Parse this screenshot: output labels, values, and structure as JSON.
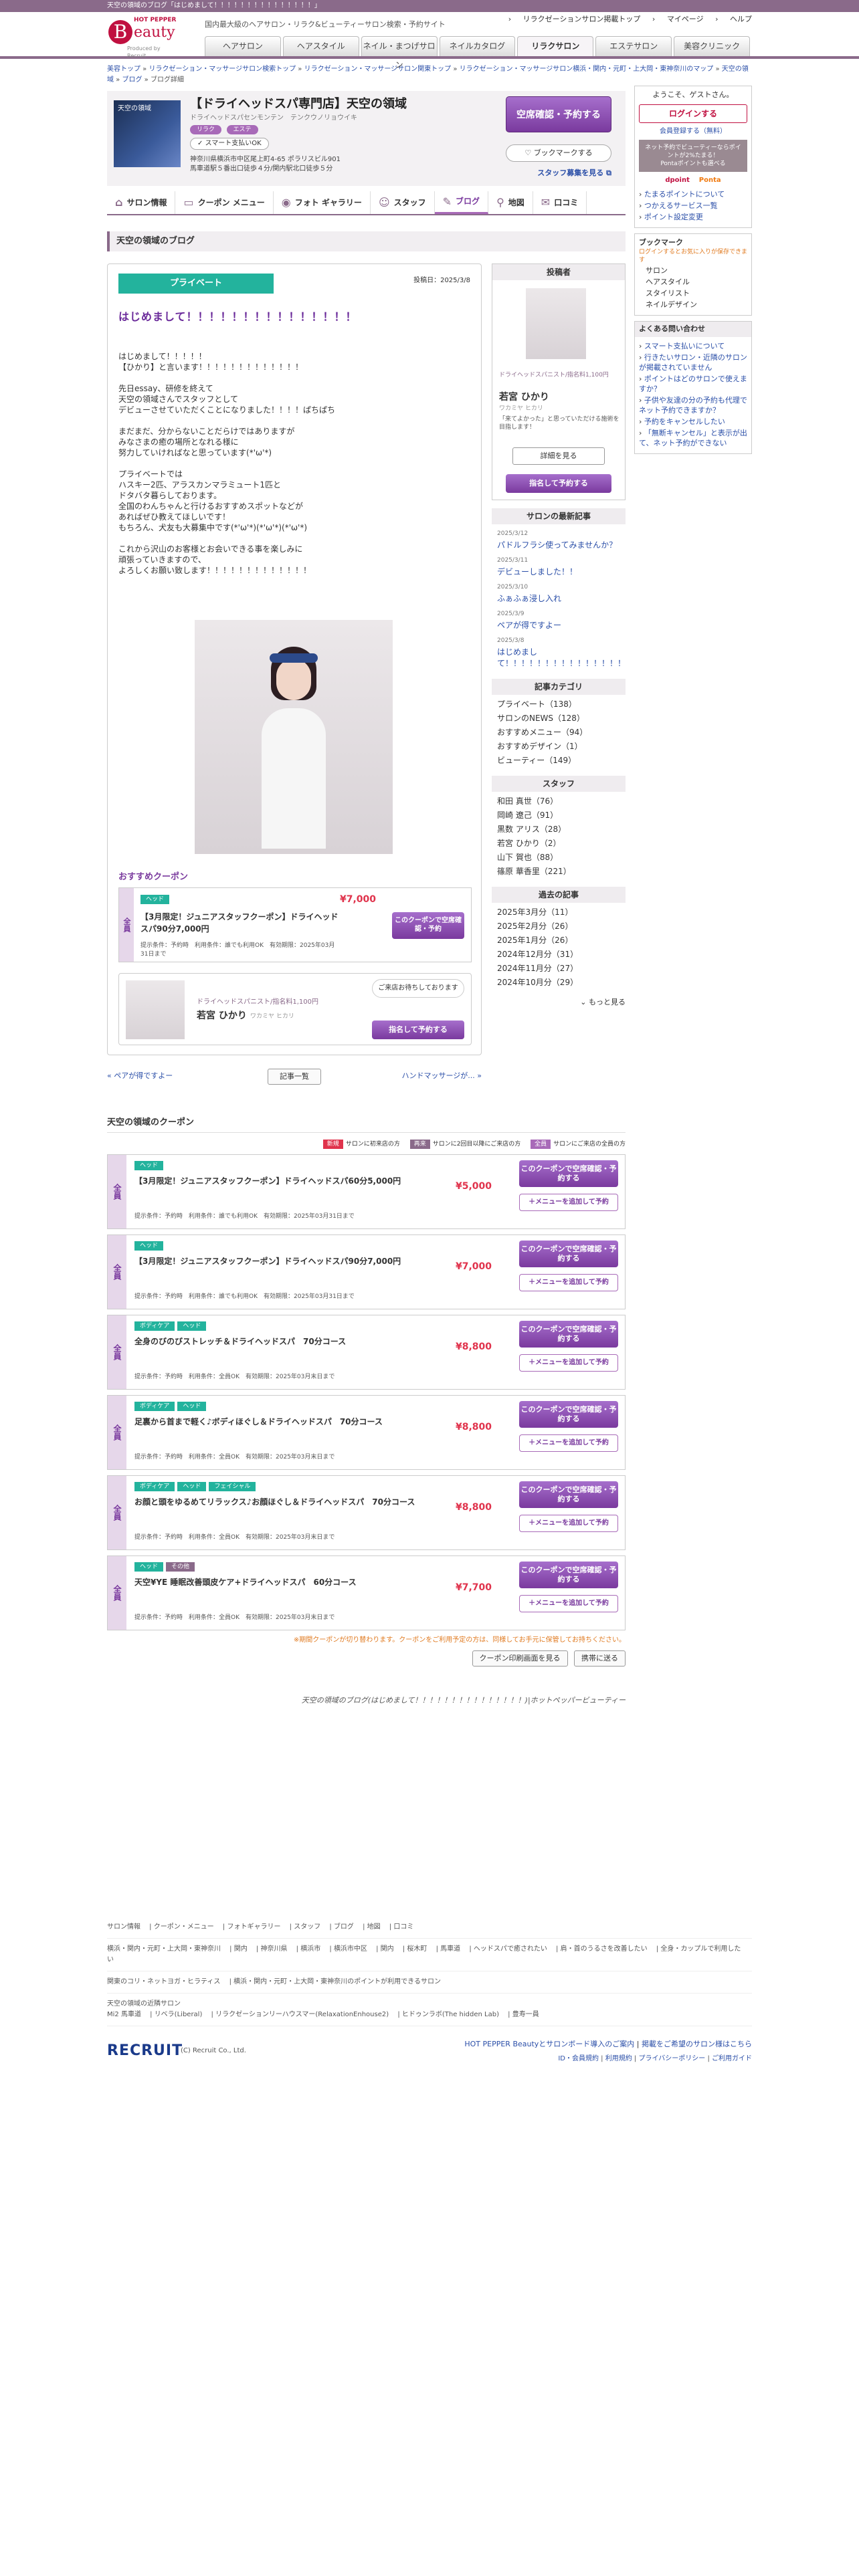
{
  "topbar": {
    "text": "天空の領域のブログ「はじめまして！！！！！！！！！！！！！！！」"
  },
  "header": {
    "logo_small": "HOT PEPPER",
    "logo_mark": "B",
    "logo_text": "eauty",
    "logo_powered": "Produced by Recruit",
    "tagline": "国内最大級のヘアサロン・リラク&ビューティーサロン検索・予約サイト",
    "util": [
      "リラクゼーションサロン掲載トップ",
      "マイページ",
      "ヘルプ"
    ],
    "tabs": [
      "ヘアサロン",
      "ヘアスタイル",
      "ネイル・まつげサロン",
      "ネイルカタログ",
      "リラクサロン",
      "エステサロン",
      "美容クリニック"
    ]
  },
  "breadcrumb": [
    "美容トップ",
    "リラクゼーション・マッサージサロン検索トップ",
    "リラクゼーション・マッサージサロン関東トップ",
    "リラクゼーション・マッサージサロン横浜・関内・元町・上大岡・東神奈川のマップ",
    "天空の領域",
    "ブログ",
    "ブログ詳細"
  ],
  "salon": {
    "image_text": "天空の領域",
    "name": "【ドライヘッドスパ専門店】天空の領域",
    "kana": "ドライヘッドスパセンモンテン　テンクウノリョウイキ",
    "tags": [
      "リラク",
      "エステ"
    ],
    "sp_label": "スマート支払いOK",
    "address": "神奈川県横浜市中区尾上町4-65 ポラリスビル901",
    "access": "馬車道駅５番出口徒歩４分/関内駅北口徒歩５分",
    "reserve_btn": "空席確認・予約する",
    "bookmark_btn": "ブックマークする",
    "staff_recruit": "スタッフ募集を見る"
  },
  "salon_nav": [
    "サロン情報",
    "クーポン メニュー",
    "フォト ギャラリー",
    "スタッフ",
    "ブログ",
    "地図",
    "口コミ"
  ],
  "salon_nav_icons": [
    "house-icon",
    "ticket-icon",
    "camera-icon",
    "people-icon",
    "pencil-icon",
    "pin-icon",
    "chat-icon"
  ],
  "section_title": "天空の領域のブログ",
  "blog": {
    "category": "プライベート",
    "date": "投稿日：2025/3/8",
    "title": "はじめまして！！！！！！！！！！！！！！！",
    "body": [
      "はじめまして！！！！！\n【ひかり】と言います！！！！！！！！！！！！！",
      "先日essay、研修を終えて\n天空の領域さんでスタッフとして\nデビューさせていただくことになりました！！！！ぱちぱち",
      "まだまだ、分からないことだらけではありますが\nみなさまの癒の場所となれる様に\n努力していければなと思っています(*'ω'*)",
      "プライベートでは\nハスキー2匹、アラスカンマラミュート1匹と\nドタバタ暮らしております。\n全国のわんちゃんと行けるおすすめスポットなどが\nあればぜひ教えてほしいです！\nもちろん、犬友も大募集中です(*'ω'*)(*'ω'*)(*'ω'*)",
      "これから沢山のお客様とお会いできる事を楽しみに\n頑張っていきますので、\nよろしくお願い致します！！！！！！！！！！！！！"
    ],
    "rec_coupon_title": "おすすめクーポン",
    "rec_coupon": {
      "side": "全員",
      "tag": "ヘッド",
      "price": "¥7,000",
      "name": "【3月限定！ジュニアスタッフクーポン】ドライヘッドスパ90分7,000円",
      "cond": "提示条件：予約時　利用条件：誰でも利用OK　有効期限：2025年03月31日まで",
      "btn": "このクーポンで空席確認・予約"
    },
    "author": {
      "role": "ドライヘッドスパニスト/指名料1,100円",
      "name": "若宮 ひかり",
      "kana": "ワカミヤ ヒカリ",
      "bubble": "ご来店お待ちしております",
      "btn": "指名して予約する"
    },
    "pager": {
      "prev": "ペアが得ですよー",
      "list": "記事一覧",
      "next": "ハンドマッサージが..."
    }
  },
  "poster_box": {
    "title": "投稿者",
    "role": "ドライヘッドスパニスト/指名料1,100円",
    "name": "若宮 ひかり",
    "kana": "ワカミヤ ヒカリ",
    "msg": "「来てよかった」と思っていただける施術を目指します！",
    "detail_btn": "詳細を見る",
    "reserve_btn": "指名して予約する"
  },
  "latest": {
    "title": "サロンの最新記事",
    "items": [
      {
        "date": "2025/3/12",
        "title": "パドルフラシ使ってみませんか？"
      },
      {
        "date": "2025/3/11",
        "title": "デビューしました！！"
      },
      {
        "date": "2025/3/10",
        "title": "ふぁふぁ浸し入れ"
      },
      {
        "date": "2025/3/9",
        "title": "ペアが得ですよー"
      },
      {
        "date": "2025/3/8",
        "title": "はじめまして！！！！！！！！！！！！！！！"
      }
    ]
  },
  "categories": {
    "title": "記事カテゴリ",
    "items": [
      "プライベート（138）",
      "サロンのNEWS（128）",
      "おすすめメニュー（94）",
      "おすすめデザイン（1）",
      "ビューティー（149）"
    ]
  },
  "staff": {
    "title": "スタッフ",
    "items": [
      "和田 真世（76）",
      "岡崎 遼己（91）",
      "黒数 アリス（28）",
      "若宮 ひかり（2）",
      "山下 賀也（88）",
      "篠原 華香里（221）"
    ]
  },
  "archive": {
    "title": "過去の記事",
    "items": [
      "2025年3月分（11）",
      "2025年2月分（26）",
      "2025年1月分（26）",
      "2024年12月分（31）",
      "2024年11月分（27）",
      "2024年10月分（29）"
    ],
    "more": "もっと見る"
  },
  "side": {
    "welcome": "ようこそ、ゲストさん。",
    "login": "ログインする",
    "register": "会員登録する（無料）",
    "points": "ネット予約でビューティーならポイントが2%たまる！",
    "points2": "Pontaポイントも選べる",
    "point_brands": [
      "dpoint",
      "Ponta"
    ],
    "links": [
      "たまるポイントについて",
      "つかえるサービス一覧",
      "ポイント設定変更"
    ],
    "bm_title": "ブックマーク",
    "bm_note": "ログインするとお気に入りが保存できます",
    "bm_items": [
      "サロン",
      "ヘアスタイル",
      "スタイリスト",
      "ネイルデザイン"
    ],
    "faq_title": "よくある問い合わせ",
    "faq": [
      "スマート支払いについて",
      "行きたいサロン・近隣のサロンが掲載されていません",
      "ポイントはどのサロンで使えますか？",
      "子供や友達の分の予約も代理でネット予約できますか？",
      "予約をキャンセルしたい",
      "「無断キャンセル」と表示が出て、ネット予約ができない"
    ]
  },
  "coupons": {
    "title": "天空の領域のクーポン",
    "legend": [
      {
        "label": "新規",
        "color": "#e0334c",
        "desc": "サロンに初来店の方"
      },
      {
        "label": "再来",
        "color": "#8a6a8a",
        "desc": "サロンに2回目以降にご来店の方"
      },
      {
        "label": "全員",
        "color": "#a86ab8",
        "desc": "サロンにご来店の全員の方"
      }
    ],
    "items": [
      {
        "side": "全員",
        "tags": [
          "ヘッド"
        ],
        "name": "【3月限定！ジュニアスタッフクーポン】ドライヘッドスパ60分5,000円",
        "price": "¥5,000",
        "cond": "提示条件：予約時　利用条件：誰でも利用OK　有効期限：2025年03月31日まで"
      },
      {
        "side": "全員",
        "tags": [
          "ヘッド"
        ],
        "name": "【3月限定！ジュニアスタッフクーポン】ドライヘッドスパ90分7,000円",
        "price": "¥7,000",
        "cond": "提示条件：予約時　利用条件：誰でも利用OK　有効期限：2025年03月31日まで"
      },
      {
        "side": "全員",
        "tags": [
          "ボディケア",
          "ヘッド"
        ],
        "name": "全身のびのびストレッチ＆ドライヘッドスパ　70分コース",
        "price": "¥8,800",
        "cond": "提示条件：予約時　利用条件：全員OK　有効期限：2025年03月末日まで"
      },
      {
        "side": "全員",
        "tags": [
          "ボディケア",
          "ヘッド"
        ],
        "name": "足裏から首まで軽く♪ボディほぐし＆ドライヘッドスパ　70分コース",
        "price": "¥8,800",
        "cond": "提示条件：予約時　利用条件：全員OK　有効期限：2025年03月末日まで"
      },
      {
        "side": "全員",
        "tags": [
          "ボディケア",
          "ヘッド",
          "フェイシャル"
        ],
        "name": "お顔と頭をゆるめてリラックス♪お顔ほぐし＆ドライヘッドスパ　70分コース",
        "price": "¥8,800",
        "cond": "提示条件：予約時　利用条件：全員OK　有効期限：2025年03月末日まで"
      },
      {
        "side": "全員",
        "tags": [
          "ヘッド",
          "その他"
        ],
        "name": "天空¥YE 睡眠改善頭皮ケア+ドライヘッドスパ　60分コース",
        "price": "¥7,700",
        "cond": "提示条件：予約時　利用条件：全員OK　有効期限：2025年03月末日まで"
      }
    ],
    "btn1": "このクーポンで空席確認・予約する",
    "btn2": "＋メニューを追加して予約",
    "note": "※期間クーポンが切り替わります。クーポンをご利用予定の方は、同様してお手元に保管してお持ちください。",
    "print_btn": "クーポン印刷画面を見る",
    "mobile_btn": "携帯に送る",
    "foot": "天空の領域のブログ(はじめまして！！！！！！！！！！！！！！！)|ホットペッパービューティー"
  },
  "footer": {
    "row1": [
      "サロン情報",
      "クーポン・メニュー",
      "フォトギャラリー",
      "スタッフ",
      "ブログ",
      "地図",
      "口コミ"
    ],
    "row2": [
      "横浜・関内・元町・上大岡・東神奈川",
      "関内",
      "神奈川県",
      "横浜市",
      "横浜市中区",
      "関内",
      "桜木町",
      "馬車道",
      "ヘッドスパで癒されたい",
      "肩・首のうるさを改善したい",
      "全身・カップルで利用したい"
    ],
    "row3": [
      "関東のコリ・ネットヨガ・ヒラティス",
      "横浜・関内・元町・上大岡・東神奈川のポイントが利用できるサロン"
    ],
    "row4_title": "天空の領域の近隣サロン",
    "row4": [
      "Mi2 馬車道",
      "リベラ(Liberal)",
      "リラクゼーションリーハウスマー(RelaxationEnhouse2)",
      "ヒドゥンラボ(The hidden Lab)",
      "豊寿一員"
    ]
  },
  "recruit": {
    "logo": "RECRUIT",
    "copy": "(C) Recruit Co., Ltd.",
    "r1": [
      "HOT PEPPER Beautyとサロンボード導入のご案内",
      "掲載をご希望のサロン様はこちら"
    ],
    "r2": [
      "ID・会員規約",
      "利用規約",
      "プライバシーポリシー",
      "ご利用ガイド"
    ]
  }
}
